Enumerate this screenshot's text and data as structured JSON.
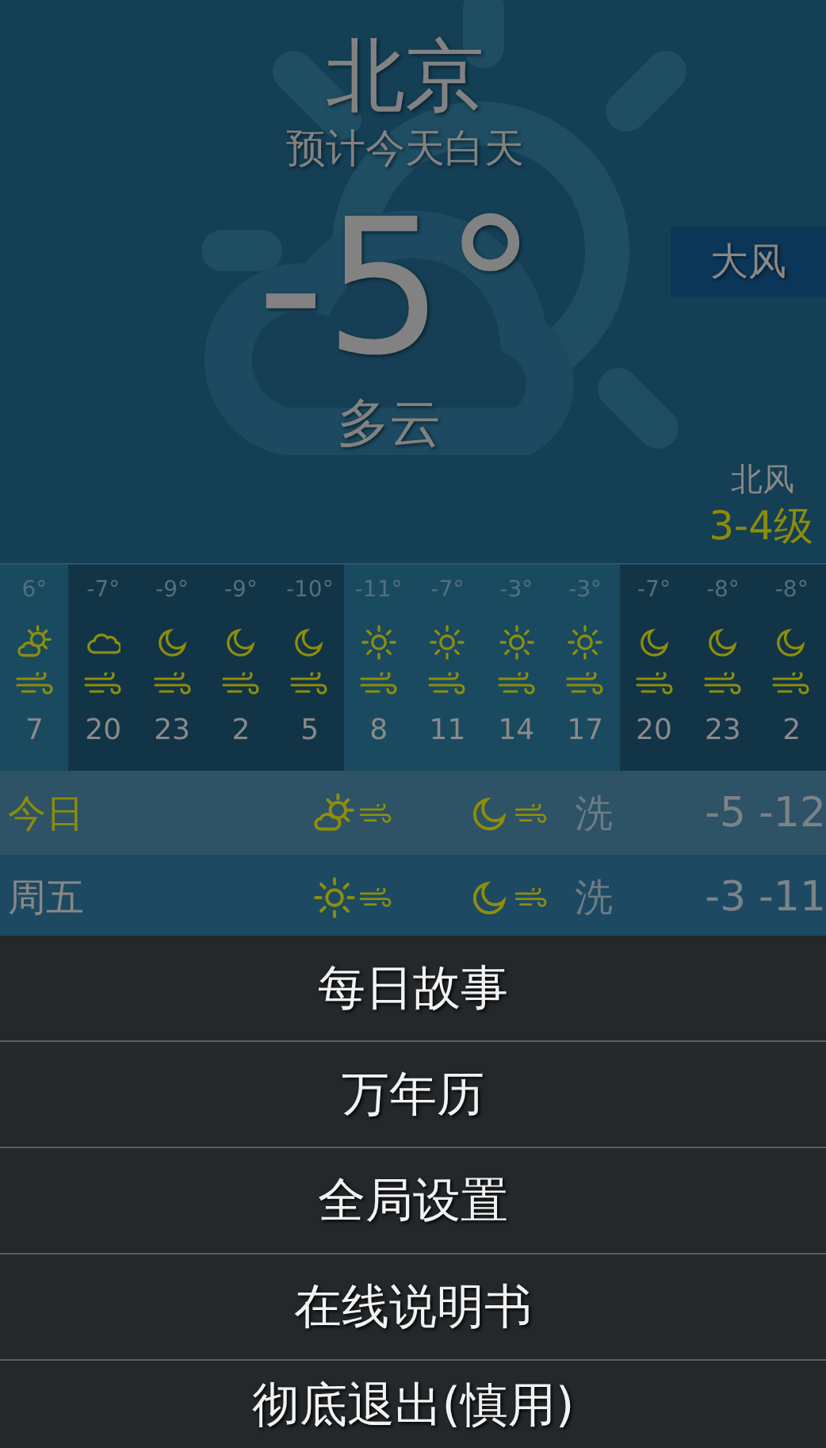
{
  "city": "北京",
  "subtitle": "预计今天白天",
  "temperature": "-5°",
  "condition": "多云",
  "alert_badge": "大风",
  "wind": {
    "direction": "北风",
    "force": "3-4级"
  },
  "hourly": [
    {
      "temp": "6°",
      "kind": "sun_cloud",
      "hour": "7",
      "night": false
    },
    {
      "temp": "-7°",
      "kind": "cloud",
      "hour": "20",
      "night": true
    },
    {
      "temp": "-9°",
      "kind": "moon",
      "hour": "23",
      "night": true
    },
    {
      "temp": "-9°",
      "kind": "moon",
      "hour": "2",
      "night": true
    },
    {
      "temp": "-10°",
      "kind": "moon",
      "hour": "5",
      "night": true
    },
    {
      "temp": "-11°",
      "kind": "sun",
      "hour": "8",
      "night": false
    },
    {
      "temp": "-7°",
      "kind": "sun",
      "hour": "11",
      "night": false
    },
    {
      "temp": "-3°",
      "kind": "sun",
      "hour": "14",
      "night": false
    },
    {
      "temp": "-3°",
      "kind": "sun",
      "hour": "17",
      "night": false
    },
    {
      "temp": "-7°",
      "kind": "moon",
      "hour": "20",
      "night": true
    },
    {
      "temp": "-8°",
      "kind": "moon",
      "hour": "23",
      "night": true
    },
    {
      "temp": "-8°",
      "kind": "moon",
      "hour": "2",
      "night": true
    }
  ],
  "daily": [
    {
      "day": "今日",
      "icons": [
        {
          "kind": "sun_cloud"
        },
        {
          "kind": "moon"
        }
      ],
      "car_wash": "洗",
      "high": "-5",
      "low": "-12",
      "selected": true
    },
    {
      "day": "周五",
      "icons": [
        {
          "kind": "sun"
        },
        {
          "kind": "moon"
        }
      ],
      "car_wash": "洗",
      "high": "-3",
      "low": "-11",
      "selected": false
    }
  ],
  "menu": [
    "每日故事",
    "万年历",
    "全局设置",
    "在线说明书",
    "彻底退出(慎用)"
  ]
}
